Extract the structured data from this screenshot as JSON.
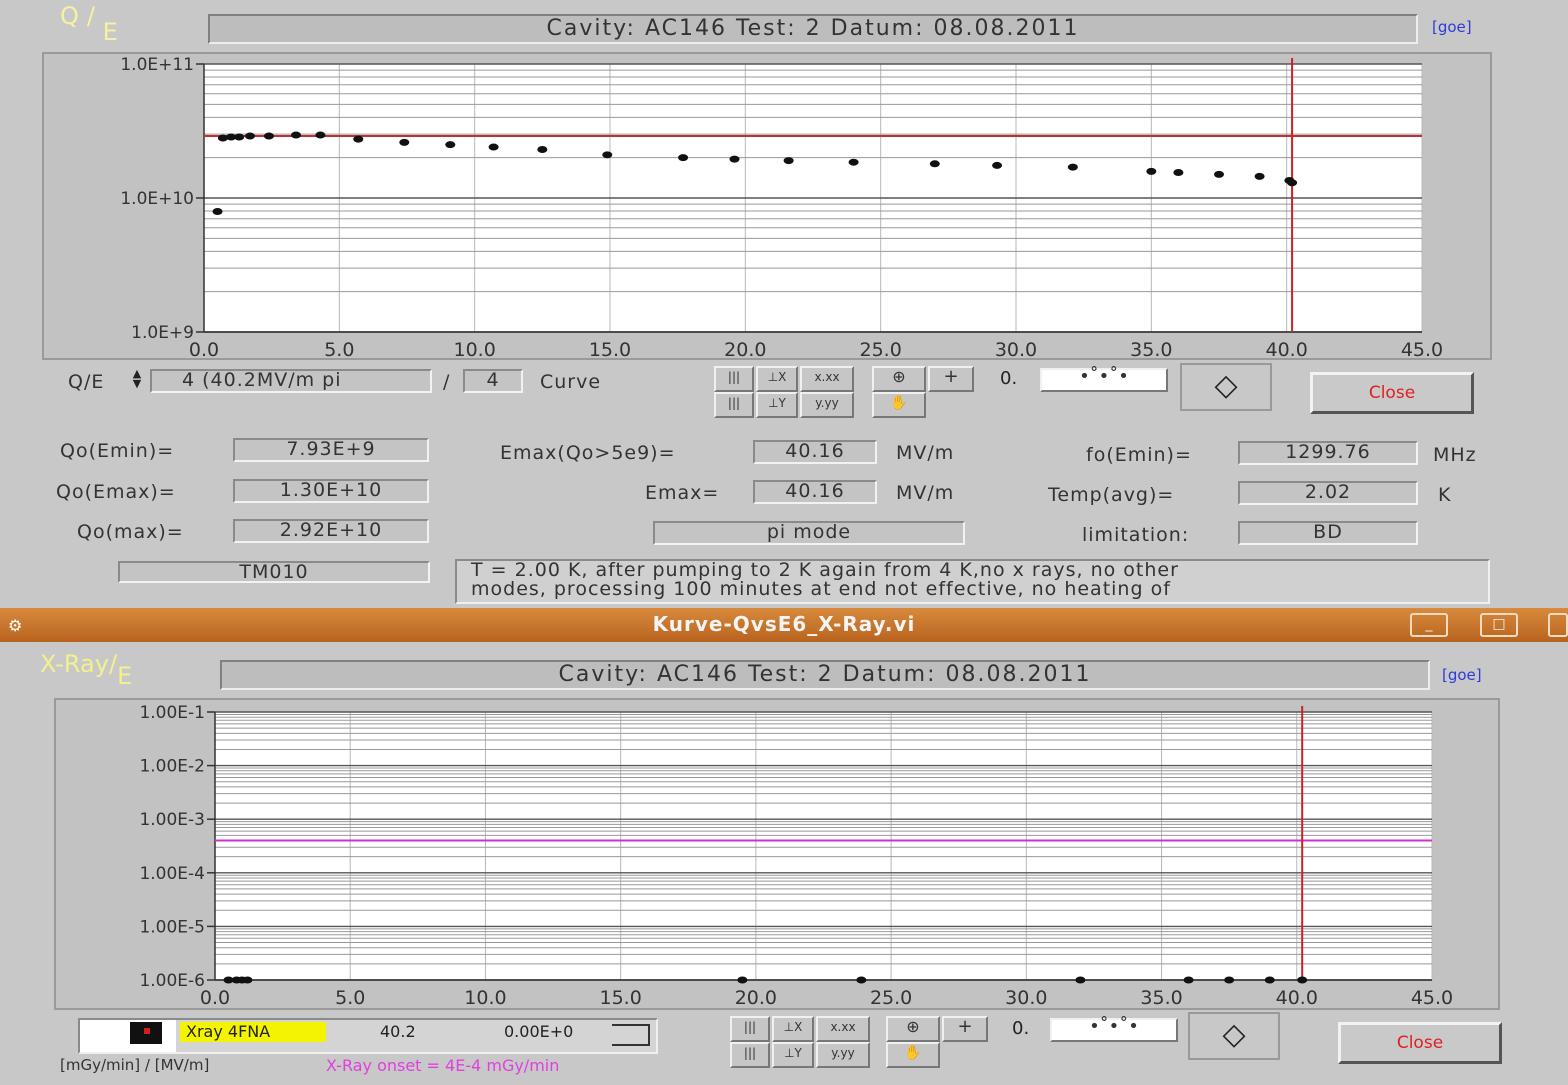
{
  "top": {
    "corner_label_q": "Q",
    "corner_label_sep": "/",
    "corner_label_e": "E",
    "header": "Cavity: AC146   Test: 2   Datum: 08.08.2011",
    "goe": "[goe]",
    "selector_label": "Q/E",
    "selector_value": "4  (40.2MV/m pi",
    "selector_sep": "/",
    "selector_count": "4",
    "selector_suffix": "Curve",
    "tool_xfmt": "x.xx",
    "tool_yfmt": "y.yy",
    "cursor_readout": "0.",
    "close": "Close",
    "fields": {
      "qo_emin_label": "Qo(Emin)=",
      "qo_emin_value": "7.93E+9",
      "qo_emax_label": "Qo(Emax)=",
      "qo_emax_value": "1.30E+10",
      "qo_max_label": "Qo(max)=",
      "qo_max_value": "2.92E+10",
      "mode_field": "TM010",
      "emax_qo_label": "Emax(Qo>5e9)=",
      "emax_qo_value": "40.16",
      "emax_qo_unit": "MV/m",
      "emax_label": "Emax=",
      "emax_value": "40.16",
      "emax_unit": "MV/m",
      "pi_mode": "pi mode",
      "fo_label": "fo(Emin)=",
      "fo_value": "1299.76",
      "fo_unit": "MHz",
      "temp_label": "Temp(avg)=",
      "temp_value": "2.02",
      "temp_unit": "K",
      "limit_label": "limitation:",
      "limit_value": "BD"
    },
    "comment_line1": "T = 2.00 K, after pumping to 2 K again from 4 K,no x rays, no other",
    "comment_line2": "modes, processing 100 minutes at end not effective, no heating of"
  },
  "window": {
    "title": "Kurve-QvsE6_X-Ray.vi",
    "minimize": "_",
    "maximize": "□"
  },
  "bottom": {
    "corner_label": "X-Ray",
    "corner_label_sep": "/",
    "corner_label_e": "E",
    "header": "Cavity: AC146   Test: 2   Datum: 08.08.2011",
    "goe": "[goe]",
    "legend_name": "Xray 4FNA",
    "legend_value": "40.2",
    "legend_value2": "0.00E+0",
    "tool_xfmt": "x.xx",
    "tool_yfmt": "y.yy",
    "cursor_readout": "0.",
    "close": "Close",
    "units_label": "[mGy/min] / [MV/m]",
    "onset_label": "X-Ray onset = 4E-4 mGy/min"
  },
  "chart_data": [
    {
      "type": "scatter",
      "title": "",
      "xlabel": "",
      "ylabel": "",
      "xlim": [
        0,
        45
      ],
      "ylim": [
        1000000000.0,
        100000000000.0
      ],
      "yscale": "log",
      "grid": true,
      "x_ticks": [
        "0.0",
        "5.0",
        "10.0",
        "15.0",
        "20.0",
        "25.0",
        "30.0",
        "35.0",
        "40.0",
        "45.0"
      ],
      "y_ticks": [
        "1.0E+11",
        "1.0E+10",
        "1.0E+9"
      ],
      "reference_line_y": 29000000000.0,
      "cursor_x": 40.2,
      "colors": {
        "points": "#111111",
        "reference": "#c03030",
        "cursor": "#d02020",
        "plot_bg": "#ffffff"
      },
      "series": [
        {
          "x": [
            0.5,
            0.7,
            1.0,
            1.3,
            1.7,
            2.4,
            3.4,
            4.3,
            5.7,
            7.4,
            9.1,
            10.7,
            12.5,
            14.9,
            17.7,
            19.6,
            21.6,
            24.0,
            27.0,
            29.3,
            32.1,
            35.0,
            36.0,
            37.5,
            39.0,
            40.1,
            40.2
          ],
          "y": [
            7930000000.0,
            28000000000.0,
            28500000000.0,
            28500000000.0,
            29000000000.0,
            29000000000.0,
            29500000000.0,
            29500000000.0,
            27500000000.0,
            26000000000.0,
            25000000000.0,
            24000000000.0,
            23000000000.0,
            21000000000.0,
            20000000000.0,
            19500000000.0,
            19000000000.0,
            18500000000.0,
            18000000000.0,
            17500000000.0,
            17000000000.0,
            15800000000.0,
            15500000000.0,
            15000000000.0,
            14500000000.0,
            13500000000.0,
            13000000000.0
          ]
        }
      ]
    },
    {
      "type": "scatter",
      "title": "",
      "xlabel": "",
      "ylabel": "",
      "xlim": [
        0,
        45
      ],
      "ylim": [
        1e-06,
        0.1
      ],
      "yscale": "log",
      "grid": true,
      "x_ticks": [
        "0.0",
        "5.0",
        "10.0",
        "15.0",
        "20.0",
        "25.0",
        "30.0",
        "35.0",
        "40.0",
        "45.0"
      ],
      "y_ticks": [
        "1.00E-1",
        "1.00E-2",
        "1.00E-3",
        "1.00E-4",
        "1.00E-5",
        "1.00E-6"
      ],
      "reference_line_y": 0.0004,
      "cursor_x": 40.2,
      "colors": {
        "points": "#111111",
        "reference": "#d030d0",
        "cursor": "#d02020",
        "plot_bg": "#ffffff"
      },
      "series": [
        {
          "x": [
            0.5,
            0.8,
            1.0,
            1.2,
            19.5,
            23.9,
            32.0,
            36.0,
            37.5,
            39.0,
            40.2
          ],
          "y": [
            1e-06,
            1e-06,
            1e-06,
            1e-06,
            1e-06,
            1e-06,
            1e-06,
            1e-06,
            1e-06,
            1e-06,
            1e-06
          ]
        }
      ]
    }
  ]
}
